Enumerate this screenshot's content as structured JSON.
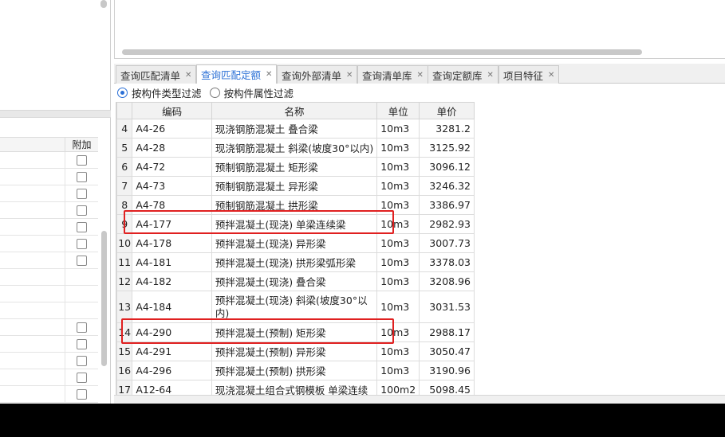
{
  "tabs": [
    {
      "label": "查询匹配清单",
      "active": false
    },
    {
      "label": "查询匹配定额",
      "active": true
    },
    {
      "label": "查询外部清单",
      "active": false
    },
    {
      "label": "查询清单库",
      "active": false
    },
    {
      "label": "查询定额库",
      "active": false
    },
    {
      "label": "项目特征",
      "active": false
    }
  ],
  "filters": {
    "by_type": {
      "label": "按构件类型过滤",
      "selected": true
    },
    "by_attr": {
      "label": "按构件属性过滤",
      "selected": false
    }
  },
  "left_panel": {
    "column_header": "附加",
    "checkbox_rows": 7
  },
  "table": {
    "headers": {
      "code": "编码",
      "name": "名称",
      "unit": "单位",
      "price": "单价"
    },
    "rows": [
      {
        "idx": "4",
        "code": "A4-26",
        "name": "现浇钢筋混凝土 叠合梁",
        "unit": "10m3",
        "price": "3281.2"
      },
      {
        "idx": "5",
        "code": "A4-28",
        "name": "现浇钢筋混凝土 斜梁(坡度30°以内)",
        "unit": "10m3",
        "price": "3125.92"
      },
      {
        "idx": "6",
        "code": "A4-72",
        "name": "预制钢筋混凝土 矩形梁",
        "unit": "10m3",
        "price": "3096.12"
      },
      {
        "idx": "7",
        "code": "A4-73",
        "name": "预制钢筋混凝土 异形梁",
        "unit": "10m3",
        "price": "3246.32"
      },
      {
        "idx": "8",
        "code": "A4-78",
        "name": "预制钢筋混凝土 拱形梁",
        "unit": "10m3",
        "price": "3386.97"
      },
      {
        "idx": "9",
        "code": "A4-177",
        "name": "预拌混凝土(现浇) 单梁连续梁",
        "unit": "10m3",
        "price": "2982.93"
      },
      {
        "idx": "10",
        "code": "A4-178",
        "name": "预拌混凝土(现浇) 异形梁",
        "unit": "10m3",
        "price": "3007.73"
      },
      {
        "idx": "11",
        "code": "A4-181",
        "name": "预拌混凝土(现浇) 拱形梁弧形梁",
        "unit": "10m3",
        "price": "3378.03"
      },
      {
        "idx": "12",
        "code": "A4-182",
        "name": "预拌混凝土(现浇) 叠合梁",
        "unit": "10m3",
        "price": "3208.96"
      },
      {
        "idx": "13",
        "code": "A4-184",
        "name": "预拌混凝土(现浇) 斜梁(坡度30°以内)",
        "unit": "10m3",
        "price": "3031.53"
      },
      {
        "idx": "14",
        "code": "A4-290",
        "name": "预拌混凝土(预制) 矩形梁",
        "unit": "10m3",
        "price": "2988.17"
      },
      {
        "idx": "15",
        "code": "A4-291",
        "name": "预拌混凝土(预制) 异形梁",
        "unit": "10m3",
        "price": "3050.47"
      },
      {
        "idx": "16",
        "code": "A4-296",
        "name": "预拌混凝土(预制) 拱形梁",
        "unit": "10m3",
        "price": "3190.96"
      },
      {
        "idx": "17",
        "code": "A12-64",
        "name": "现浇混凝土组合式钢模板 单梁连续",
        "unit": "100m2",
        "price": "5098.45"
      }
    ]
  },
  "annotation_color": "#e02020"
}
